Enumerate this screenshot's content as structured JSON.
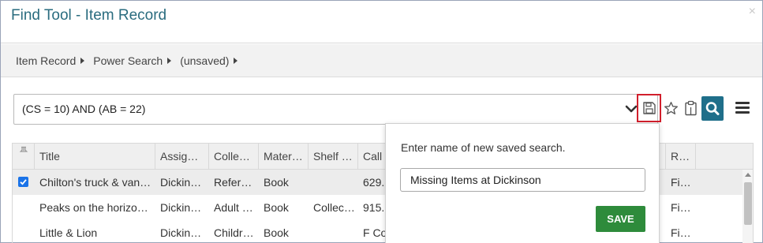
{
  "window": {
    "title": "Find Tool - Item Record",
    "close_glyph": "×"
  },
  "breadcrumb": [
    "Item Record",
    "Power Search",
    "(unsaved)"
  ],
  "search": {
    "query": "(CS = 10) AND (AB = 22)"
  },
  "toolbar": {
    "icons": [
      "chevron-down-icon",
      "save-icon",
      "star-icon",
      "clipboard-icon",
      "search-icon",
      "hamburger-menu-icon"
    ],
    "highlight_color": "#d11f2c",
    "search_button_color": "#1f6f8a"
  },
  "grid": {
    "columns": [
      "Title",
      "Assig…",
      "Colle…",
      "Mater…",
      "Shelf …",
      "Call",
      "R…"
    ],
    "rows": [
      {
        "selected": true,
        "title": "Chilton's truck & van…",
        "assigned": "Dickin…",
        "collection": "Refer…",
        "material": "Book",
        "shelf": "",
        "call": "629.2",
        "r": "Fi…"
      },
      {
        "selected": false,
        "title": "Peaks on the horizo…",
        "assigned": "Dickin…",
        "collection": "Adult …",
        "material": "Book",
        "shelf": "Collec…",
        "call": "915.",
        "r": "Fi…"
      },
      {
        "selected": false,
        "title": "Little & Lion",
        "assigned": "Dickin…",
        "collection": "Childr…",
        "material": "Book",
        "shelf": "",
        "call": "F Co",
        "r": "Fi…"
      }
    ]
  },
  "popup": {
    "label": "Enter name of new saved search.",
    "input_value": "Missing Items at Dickinson",
    "save_label": "SAVE",
    "save_color": "#2e8b3b"
  }
}
